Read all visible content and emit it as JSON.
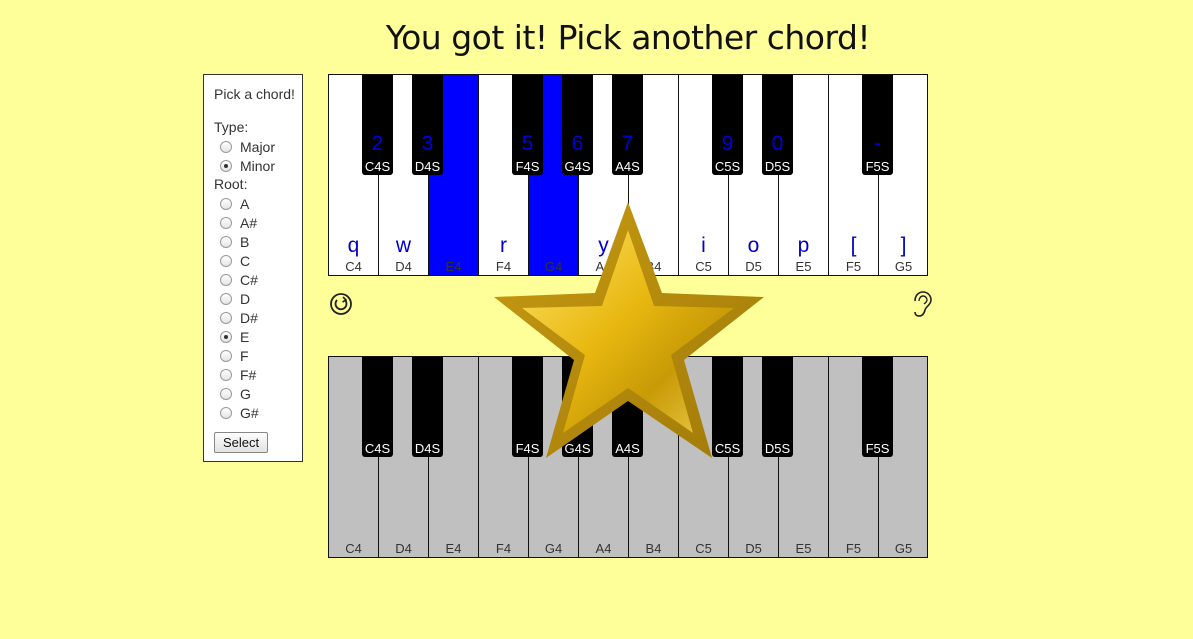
{
  "heading": "You got it! Pick another chord!",
  "panel": {
    "title": "Pick a chord!",
    "type_label": "Type:",
    "types": [
      {
        "label": "Major",
        "checked": false
      },
      {
        "label": "Minor",
        "checked": true
      }
    ],
    "root_label": "Root:",
    "roots": [
      {
        "label": "A",
        "checked": false
      },
      {
        "label": "A#",
        "checked": false
      },
      {
        "label": "B",
        "checked": false
      },
      {
        "label": "C",
        "checked": false
      },
      {
        "label": "C#",
        "checked": false
      },
      {
        "label": "D",
        "checked": false
      },
      {
        "label": "D#",
        "checked": false
      },
      {
        "label": "E",
        "checked": true
      },
      {
        "label": "F",
        "checked": false
      },
      {
        "label": "F#",
        "checked": false
      },
      {
        "label": "G",
        "checked": false
      },
      {
        "label": "G#",
        "checked": false
      }
    ],
    "select_label": "Select"
  },
  "top_keyboard": {
    "white_keys": [
      {
        "note": "C4",
        "kbd": "q",
        "active": false
      },
      {
        "note": "D4",
        "kbd": "w",
        "active": false
      },
      {
        "note": "E4",
        "kbd": "",
        "active": true
      },
      {
        "note": "F4",
        "kbd": "r",
        "active": false
      },
      {
        "note": "G4",
        "kbd": "",
        "active": true
      },
      {
        "note": "A4",
        "kbd": "y",
        "active": false
      },
      {
        "note": "B4",
        "kbd": "",
        "active": false
      },
      {
        "note": "C5",
        "kbd": "i",
        "active": false
      },
      {
        "note": "D5",
        "kbd": "o",
        "active": false
      },
      {
        "note": "E5",
        "kbd": "p",
        "active": false
      },
      {
        "note": "F5",
        "kbd": "[",
        "active": false
      },
      {
        "note": "G5",
        "kbd": "]",
        "active": false
      }
    ],
    "black_keys": [
      {
        "note": "C4S",
        "kbd": "2",
        "after_white": 0
      },
      {
        "note": "D4S",
        "kbd": "3",
        "after_white": 1
      },
      {
        "note": "F4S",
        "kbd": "5",
        "after_white": 3
      },
      {
        "note": "G4S",
        "kbd": "6",
        "after_white": 4
      },
      {
        "note": "A4S",
        "kbd": "7",
        "after_white": 5
      },
      {
        "note": "C5S",
        "kbd": "9",
        "after_white": 7
      },
      {
        "note": "D5S",
        "kbd": "0",
        "after_white": 8
      },
      {
        "note": "F5S",
        "kbd": "-",
        "after_white": 10
      }
    ]
  },
  "bottom_keyboard": {
    "white_keys": [
      "C4",
      "D4",
      "E4",
      "F4",
      "G4",
      "A4",
      "B4",
      "C5",
      "D5",
      "E5",
      "F5",
      "G5"
    ],
    "black_keys": [
      {
        "note": "C4S",
        "after_white": 0
      },
      {
        "note": "D4S",
        "after_white": 1
      },
      {
        "note": "F4S",
        "after_white": 3
      },
      {
        "note": "G4S",
        "after_white": 4
      },
      {
        "note": "A4S",
        "after_white": 5
      },
      {
        "note": "C5S",
        "after_white": 7
      },
      {
        "note": "D5S",
        "after_white": 8
      },
      {
        "note": "F5S",
        "after_white": 10
      }
    ]
  },
  "colors": {
    "background": "#ffff99",
    "active_key": "#0000ff",
    "key_label": "#0000cc",
    "bottom_white": "#c0c0c0",
    "star_gold": "#d4a514"
  },
  "icons": {
    "replay": "replay-icon",
    "listen": "ear-icon",
    "success": "star-icon"
  }
}
